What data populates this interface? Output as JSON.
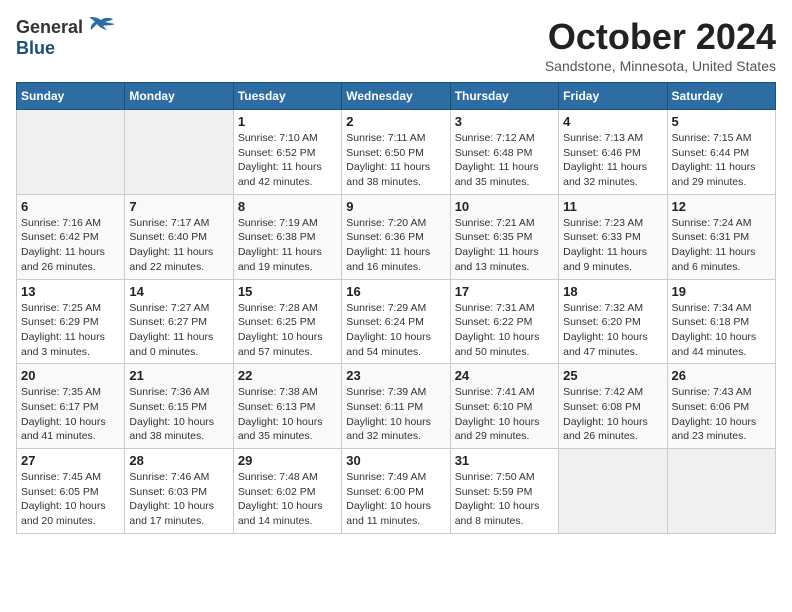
{
  "logo": {
    "general": "General",
    "blue": "Blue"
  },
  "title": "October 2024",
  "location": "Sandstone, Minnesota, United States",
  "days_of_week": [
    "Sunday",
    "Monday",
    "Tuesday",
    "Wednesday",
    "Thursday",
    "Friday",
    "Saturday"
  ],
  "weeks": [
    [
      {
        "day": "",
        "info": ""
      },
      {
        "day": "",
        "info": ""
      },
      {
        "day": "1",
        "info": "Sunrise: 7:10 AM\nSunset: 6:52 PM\nDaylight: 11 hours and 42 minutes."
      },
      {
        "day": "2",
        "info": "Sunrise: 7:11 AM\nSunset: 6:50 PM\nDaylight: 11 hours and 38 minutes."
      },
      {
        "day": "3",
        "info": "Sunrise: 7:12 AM\nSunset: 6:48 PM\nDaylight: 11 hours and 35 minutes."
      },
      {
        "day": "4",
        "info": "Sunrise: 7:13 AM\nSunset: 6:46 PM\nDaylight: 11 hours and 32 minutes."
      },
      {
        "day": "5",
        "info": "Sunrise: 7:15 AM\nSunset: 6:44 PM\nDaylight: 11 hours and 29 minutes."
      }
    ],
    [
      {
        "day": "6",
        "info": "Sunrise: 7:16 AM\nSunset: 6:42 PM\nDaylight: 11 hours and 26 minutes."
      },
      {
        "day": "7",
        "info": "Sunrise: 7:17 AM\nSunset: 6:40 PM\nDaylight: 11 hours and 22 minutes."
      },
      {
        "day": "8",
        "info": "Sunrise: 7:19 AM\nSunset: 6:38 PM\nDaylight: 11 hours and 19 minutes."
      },
      {
        "day": "9",
        "info": "Sunrise: 7:20 AM\nSunset: 6:36 PM\nDaylight: 11 hours and 16 minutes."
      },
      {
        "day": "10",
        "info": "Sunrise: 7:21 AM\nSunset: 6:35 PM\nDaylight: 11 hours and 13 minutes."
      },
      {
        "day": "11",
        "info": "Sunrise: 7:23 AM\nSunset: 6:33 PM\nDaylight: 11 hours and 9 minutes."
      },
      {
        "day": "12",
        "info": "Sunrise: 7:24 AM\nSunset: 6:31 PM\nDaylight: 11 hours and 6 minutes."
      }
    ],
    [
      {
        "day": "13",
        "info": "Sunrise: 7:25 AM\nSunset: 6:29 PM\nDaylight: 11 hours and 3 minutes."
      },
      {
        "day": "14",
        "info": "Sunrise: 7:27 AM\nSunset: 6:27 PM\nDaylight: 11 hours and 0 minutes."
      },
      {
        "day": "15",
        "info": "Sunrise: 7:28 AM\nSunset: 6:25 PM\nDaylight: 10 hours and 57 minutes."
      },
      {
        "day": "16",
        "info": "Sunrise: 7:29 AM\nSunset: 6:24 PM\nDaylight: 10 hours and 54 minutes."
      },
      {
        "day": "17",
        "info": "Sunrise: 7:31 AM\nSunset: 6:22 PM\nDaylight: 10 hours and 50 minutes."
      },
      {
        "day": "18",
        "info": "Sunrise: 7:32 AM\nSunset: 6:20 PM\nDaylight: 10 hours and 47 minutes."
      },
      {
        "day": "19",
        "info": "Sunrise: 7:34 AM\nSunset: 6:18 PM\nDaylight: 10 hours and 44 minutes."
      }
    ],
    [
      {
        "day": "20",
        "info": "Sunrise: 7:35 AM\nSunset: 6:17 PM\nDaylight: 10 hours and 41 minutes."
      },
      {
        "day": "21",
        "info": "Sunrise: 7:36 AM\nSunset: 6:15 PM\nDaylight: 10 hours and 38 minutes."
      },
      {
        "day": "22",
        "info": "Sunrise: 7:38 AM\nSunset: 6:13 PM\nDaylight: 10 hours and 35 minutes."
      },
      {
        "day": "23",
        "info": "Sunrise: 7:39 AM\nSunset: 6:11 PM\nDaylight: 10 hours and 32 minutes."
      },
      {
        "day": "24",
        "info": "Sunrise: 7:41 AM\nSunset: 6:10 PM\nDaylight: 10 hours and 29 minutes."
      },
      {
        "day": "25",
        "info": "Sunrise: 7:42 AM\nSunset: 6:08 PM\nDaylight: 10 hours and 26 minutes."
      },
      {
        "day": "26",
        "info": "Sunrise: 7:43 AM\nSunset: 6:06 PM\nDaylight: 10 hours and 23 minutes."
      }
    ],
    [
      {
        "day": "27",
        "info": "Sunrise: 7:45 AM\nSunset: 6:05 PM\nDaylight: 10 hours and 20 minutes."
      },
      {
        "day": "28",
        "info": "Sunrise: 7:46 AM\nSunset: 6:03 PM\nDaylight: 10 hours and 17 minutes."
      },
      {
        "day": "29",
        "info": "Sunrise: 7:48 AM\nSunset: 6:02 PM\nDaylight: 10 hours and 14 minutes."
      },
      {
        "day": "30",
        "info": "Sunrise: 7:49 AM\nSunset: 6:00 PM\nDaylight: 10 hours and 11 minutes."
      },
      {
        "day": "31",
        "info": "Sunrise: 7:50 AM\nSunset: 5:59 PM\nDaylight: 10 hours and 8 minutes."
      },
      {
        "day": "",
        "info": ""
      },
      {
        "day": "",
        "info": ""
      }
    ]
  ]
}
